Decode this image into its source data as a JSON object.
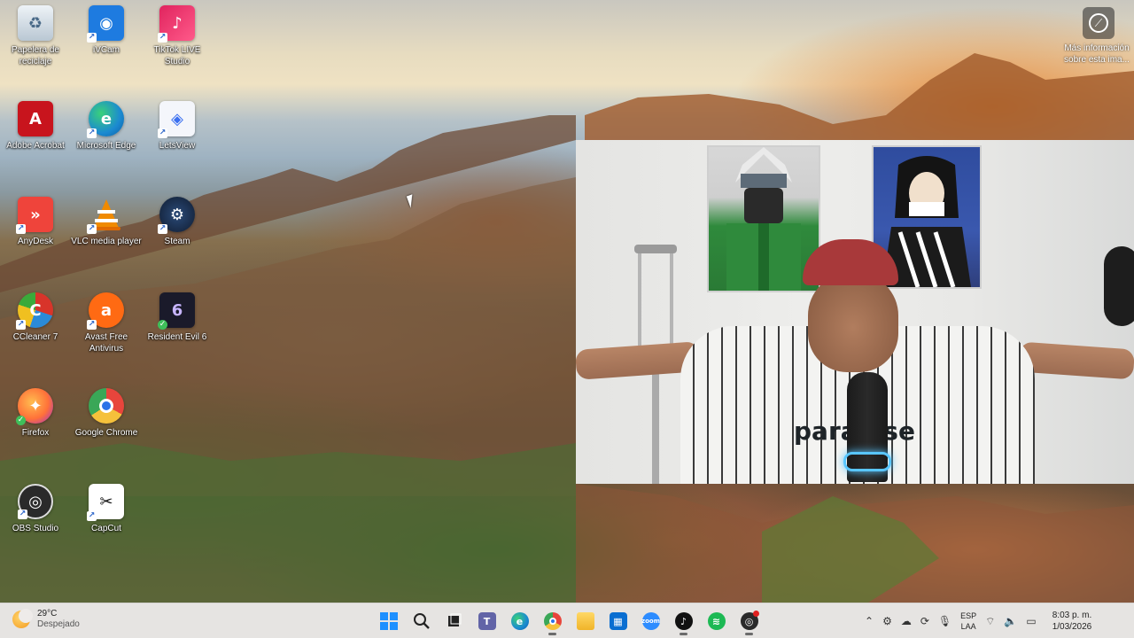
{
  "desktop": {
    "icons": [
      {
        "label": "Papelera de reciclaje",
        "icon": "recycle-bin-icon",
        "color": "#dfe7ee"
      },
      {
        "label": "iVCam",
        "icon": "ivcam-icon",
        "color": "#1e7be0"
      },
      {
        "label": "TikTok LIVE Studio",
        "icon": "tiktok-live-icon",
        "color": "#e0245e"
      },
      {
        "label": "Adobe Acrobat",
        "icon": "adobe-acrobat-icon",
        "color": "#c8141d"
      },
      {
        "label": "Microsoft Edge",
        "icon": "microsoft-edge-icon",
        "color": "#1b8ad1"
      },
      {
        "label": "LetsView",
        "icon": "letsview-icon",
        "color": "#f4f6fb"
      },
      {
        "label": "AnyDesk",
        "icon": "anydesk-icon",
        "color": "#ef443b"
      },
      {
        "label": "VLC media player",
        "icon": "vlc-icon",
        "color": "#f08a00"
      },
      {
        "label": "Steam",
        "icon": "steam-icon",
        "color": "#1b2a44"
      },
      {
        "label": "CCleaner 7",
        "icon": "ccleaner-icon",
        "color": "#d8342a"
      },
      {
        "label": "Avast Free Antivirus",
        "icon": "avast-icon",
        "color": "#ff6a13"
      },
      {
        "label": "Resident Evil 6",
        "icon": "resident-evil-icon",
        "color": "#1a1a2a"
      },
      {
        "label": "Firefox",
        "icon": "firefox-icon",
        "color": "#ff7139"
      },
      {
        "label": "Google Chrome",
        "icon": "chrome-icon",
        "color": "#ffffff"
      },
      {
        "label": "OBS Studio",
        "icon": "obs-icon",
        "color": "#2a2a2a"
      },
      {
        "label": "CapCut",
        "icon": "capcut-icon",
        "color": "#ffffff"
      }
    ]
  },
  "wallpaper_info": {
    "label": "Más información sobre esta ima..."
  },
  "webcam": {
    "shirt_text": "paradise"
  },
  "taskbar": {
    "weather": {
      "temperature": "29°C",
      "condition": "Despejado"
    },
    "apps": [
      {
        "name": "start",
        "icon": "windows-start-icon",
        "color": "#1e90ff",
        "active": false
      },
      {
        "name": "search",
        "icon": "search-icon",
        "color": "#333333",
        "active": false
      },
      {
        "name": "task-view",
        "icon": "task-view-icon",
        "color": "#222222",
        "active": false
      },
      {
        "name": "teams",
        "icon": "teams-icon",
        "color": "#6264a7",
        "active": false
      },
      {
        "name": "edge",
        "icon": "microsoft-edge-icon",
        "color": "#1b8ad1",
        "active": false
      },
      {
        "name": "chrome",
        "icon": "chrome-icon",
        "color": "#e8453c",
        "active": true
      },
      {
        "name": "file-explorer",
        "icon": "file-explorer-icon",
        "color": "#f5c13b",
        "active": false
      },
      {
        "name": "store",
        "icon": "microsoft-store-icon",
        "color": "#0a6ed1",
        "active": false
      },
      {
        "name": "zoom",
        "icon": "zoom-icon",
        "color": "#2d8cff",
        "active": false
      },
      {
        "name": "tiktok",
        "icon": "tiktok-icon",
        "color": "#111111",
        "active": true
      },
      {
        "name": "spotify",
        "icon": "spotify-icon",
        "color": "#1db954",
        "active": false
      },
      {
        "name": "obs",
        "icon": "obs-icon",
        "color": "#2a2a2a",
        "active": true
      }
    ],
    "tray": {
      "language_top": "ESP",
      "language_bottom": "LAA",
      "time": "8:03 p. m.",
      "date": "1/03/2026"
    }
  }
}
